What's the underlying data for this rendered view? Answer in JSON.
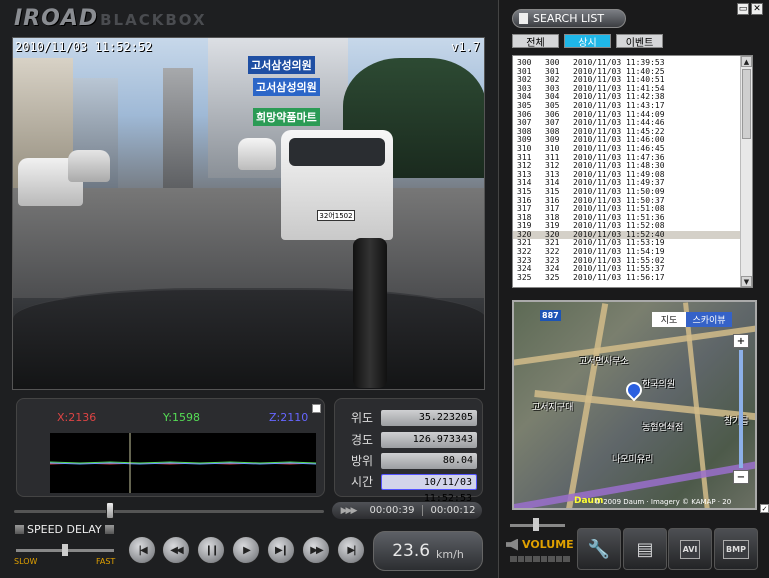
{
  "app": {
    "brand_main": "IROAD",
    "brand_sub": "BLACKBOX"
  },
  "video": {
    "timestamp": "2010/11/03 11:52:52",
    "version": "v1.7",
    "signs": [
      "고서삼성의원",
      "고서삼성의원",
      "희망약품마트"
    ],
    "plate": "32어1502"
  },
  "gsensor": {
    "x": "X:2136",
    "y": "Y:1598",
    "z": "Z:2110"
  },
  "gps": {
    "lat_label": "위도",
    "lat": "35.223205",
    "lon_label": "경도",
    "lon": "126.973343",
    "dir_label": "방위",
    "dir": "80.04",
    "time_label": "시간",
    "time": "10/11/03 11:52:53"
  },
  "playback": {
    "elapsed": "00:00:39",
    "remaining": "00:00:12"
  },
  "speed_delay": {
    "label": "SPEED DELAY",
    "slow": "SLOW",
    "fast": "FAST"
  },
  "transport": [
    "first",
    "rewind",
    "pause",
    "play",
    "step",
    "fast-forward",
    "last"
  ],
  "speed": {
    "value": "23.6",
    "unit": "km/h"
  },
  "search": {
    "title": "SEARCH LIST",
    "tabs": [
      "전체",
      "상시",
      "이벤트"
    ],
    "active_tab": "상시"
  },
  "list": {
    "rows": [
      [
        "300",
        "300",
        "2010/11/03 11:39:53"
      ],
      [
        "301",
        "301",
        "2010/11/03 11:40:25"
      ],
      [
        "302",
        "302",
        "2010/11/03 11:40:51"
      ],
      [
        "303",
        "303",
        "2010/11/03 11:41:54"
      ],
      [
        "304",
        "304",
        "2010/11/03 11:42:38"
      ],
      [
        "305",
        "305",
        "2010/11/03 11:43:17"
      ],
      [
        "306",
        "306",
        "2010/11/03 11:44:09"
      ],
      [
        "307",
        "307",
        "2010/11/03 11:44:46"
      ],
      [
        "308",
        "308",
        "2010/11/03 11:45:22"
      ],
      [
        "309",
        "309",
        "2010/11/03 11:46:00"
      ],
      [
        "310",
        "310",
        "2010/11/03 11:46:45"
      ],
      [
        "311",
        "311",
        "2010/11/03 11:47:36"
      ],
      [
        "312",
        "312",
        "2010/11/03 11:48:30"
      ],
      [
        "313",
        "313",
        "2010/11/03 11:49:08"
      ],
      [
        "314",
        "314",
        "2010/11/03 11:49:37"
      ],
      [
        "315",
        "315",
        "2010/11/03 11:50:09"
      ],
      [
        "316",
        "316",
        "2010/11/03 11:50:37"
      ],
      [
        "317",
        "317",
        "2010/11/03 11:51:08"
      ],
      [
        "318",
        "318",
        "2010/11/03 11:51:36"
      ],
      [
        "319",
        "319",
        "2010/11/03 11:52:08"
      ],
      [
        "320",
        "320",
        "2010/11/03 11:52:40"
      ],
      [
        "321",
        "321",
        "2010/11/03 11:53:19"
      ],
      [
        "322",
        "322",
        "2010/11/03 11:54:19"
      ],
      [
        "323",
        "323",
        "2010/11/03 11:55:02"
      ],
      [
        "324",
        "324",
        "2010/11/03 11:55:37"
      ],
      [
        "325",
        "325",
        "2010/11/03 11:56:17"
      ]
    ],
    "selected_index": 20
  },
  "map": {
    "tab_map": "지도",
    "tab_sky": "스카이뷰",
    "road_no": "887",
    "labels": [
      "고서면사무소",
      "한국의원",
      "고서지구대",
      "농협연쇄점",
      "나오미유리",
      "참기름"
    ],
    "copyright": "© 2009 Daum · Imagery © KAMAP · 20"
  },
  "volume": {
    "label": "VOLUME"
  },
  "tools": [
    "settings",
    "print",
    "AVI",
    "BMP"
  ],
  "colors": {
    "accent": "#1fb7e8",
    "gx": "#dd4444",
    "gy": "#55dd55",
    "gz": "#6666ff",
    "amber": "#e0a000"
  }
}
